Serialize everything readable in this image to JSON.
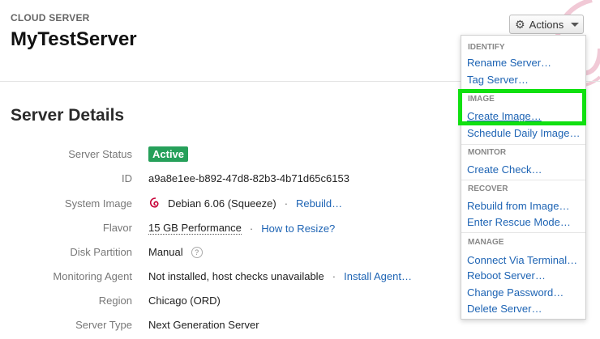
{
  "header": {
    "eyebrow": "CLOUD SERVER",
    "title": "MyTestServer",
    "actions_label": "Actions"
  },
  "section_title": "Server Details",
  "details": {
    "status": {
      "label": "Server Status",
      "value": "Active",
      "color": "#26a05a"
    },
    "id": {
      "label": "ID",
      "value": "a9a8e1ee-b892-47d8-82b3-4b71d65c6153"
    },
    "image": {
      "label": "System Image",
      "value": "Debian 6.06 (Squeeze)",
      "action": "Rebuild…"
    },
    "flavor": {
      "label": "Flavor",
      "value": "15 GB Performance",
      "action": "How to Resize?"
    },
    "disk": {
      "label": "Disk Partition",
      "value": "Manual",
      "help": "?"
    },
    "monitoring": {
      "label": "Monitoring Agent",
      "value": "Not installed, host checks unavailable",
      "action": "Install Agent…"
    },
    "region": {
      "label": "Region",
      "value": "Chicago (ORD)"
    },
    "type": {
      "label": "Server Type",
      "value": "Next Generation Server"
    }
  },
  "menu": {
    "identify": {
      "heading": "IDENTIFY",
      "items": [
        "Rename Server…",
        "Tag Server…"
      ]
    },
    "image": {
      "heading": "IMAGE",
      "items": [
        "Create Image…",
        "Schedule Daily Image…"
      ]
    },
    "monitor": {
      "heading": "MONITOR",
      "items": [
        "Create Check…"
      ]
    },
    "recover": {
      "heading": "RECOVER",
      "items": [
        "Rebuild from Image…",
        "Enter Rescue Mode…"
      ]
    },
    "manage": {
      "heading": "MANAGE",
      "items": [
        "Connect Via Terminal…",
        "Reboot Server…",
        "Change Password…",
        "Delete Server…"
      ]
    }
  },
  "colors": {
    "link": "#1e64b4",
    "highlight": "#10e010"
  }
}
